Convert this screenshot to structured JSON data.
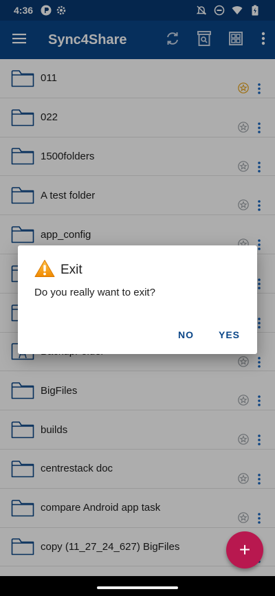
{
  "status_bar": {
    "time": "4:36"
  },
  "app_bar": {
    "title": "Sync4Share"
  },
  "folders": [
    {
      "name": "011",
      "starred": true
    },
    {
      "name": "022",
      "starred": false
    },
    {
      "name": "1500folders",
      "starred": false
    },
    {
      "name": "A test folder",
      "starred": false
    },
    {
      "name": "app_config",
      "starred": false
    },
    {
      "name": "",
      "starred": false
    },
    {
      "name": "",
      "starred": false
    },
    {
      "name": "BackupFolder",
      "starred": false
    },
    {
      "name": "BigFiles",
      "starred": false
    },
    {
      "name": "builds",
      "starred": false
    },
    {
      "name": "centrestack doc",
      "starred": false
    },
    {
      "name": "compare Android app task",
      "starred": false
    },
    {
      "name": "copy (11_27_24_627) BigFiles",
      "starred": false
    }
  ],
  "dialog": {
    "title": "Exit",
    "message": "Do you really want to exit?",
    "no_label": "NO",
    "yes_label": "YES"
  },
  "fab": {
    "symbol": "+"
  },
  "colors": {
    "primary": "#0a4688",
    "status_bar": "#083872",
    "accent": "#b8184f",
    "folder_icon": "#0a4688",
    "star_active": "#e8a317"
  }
}
